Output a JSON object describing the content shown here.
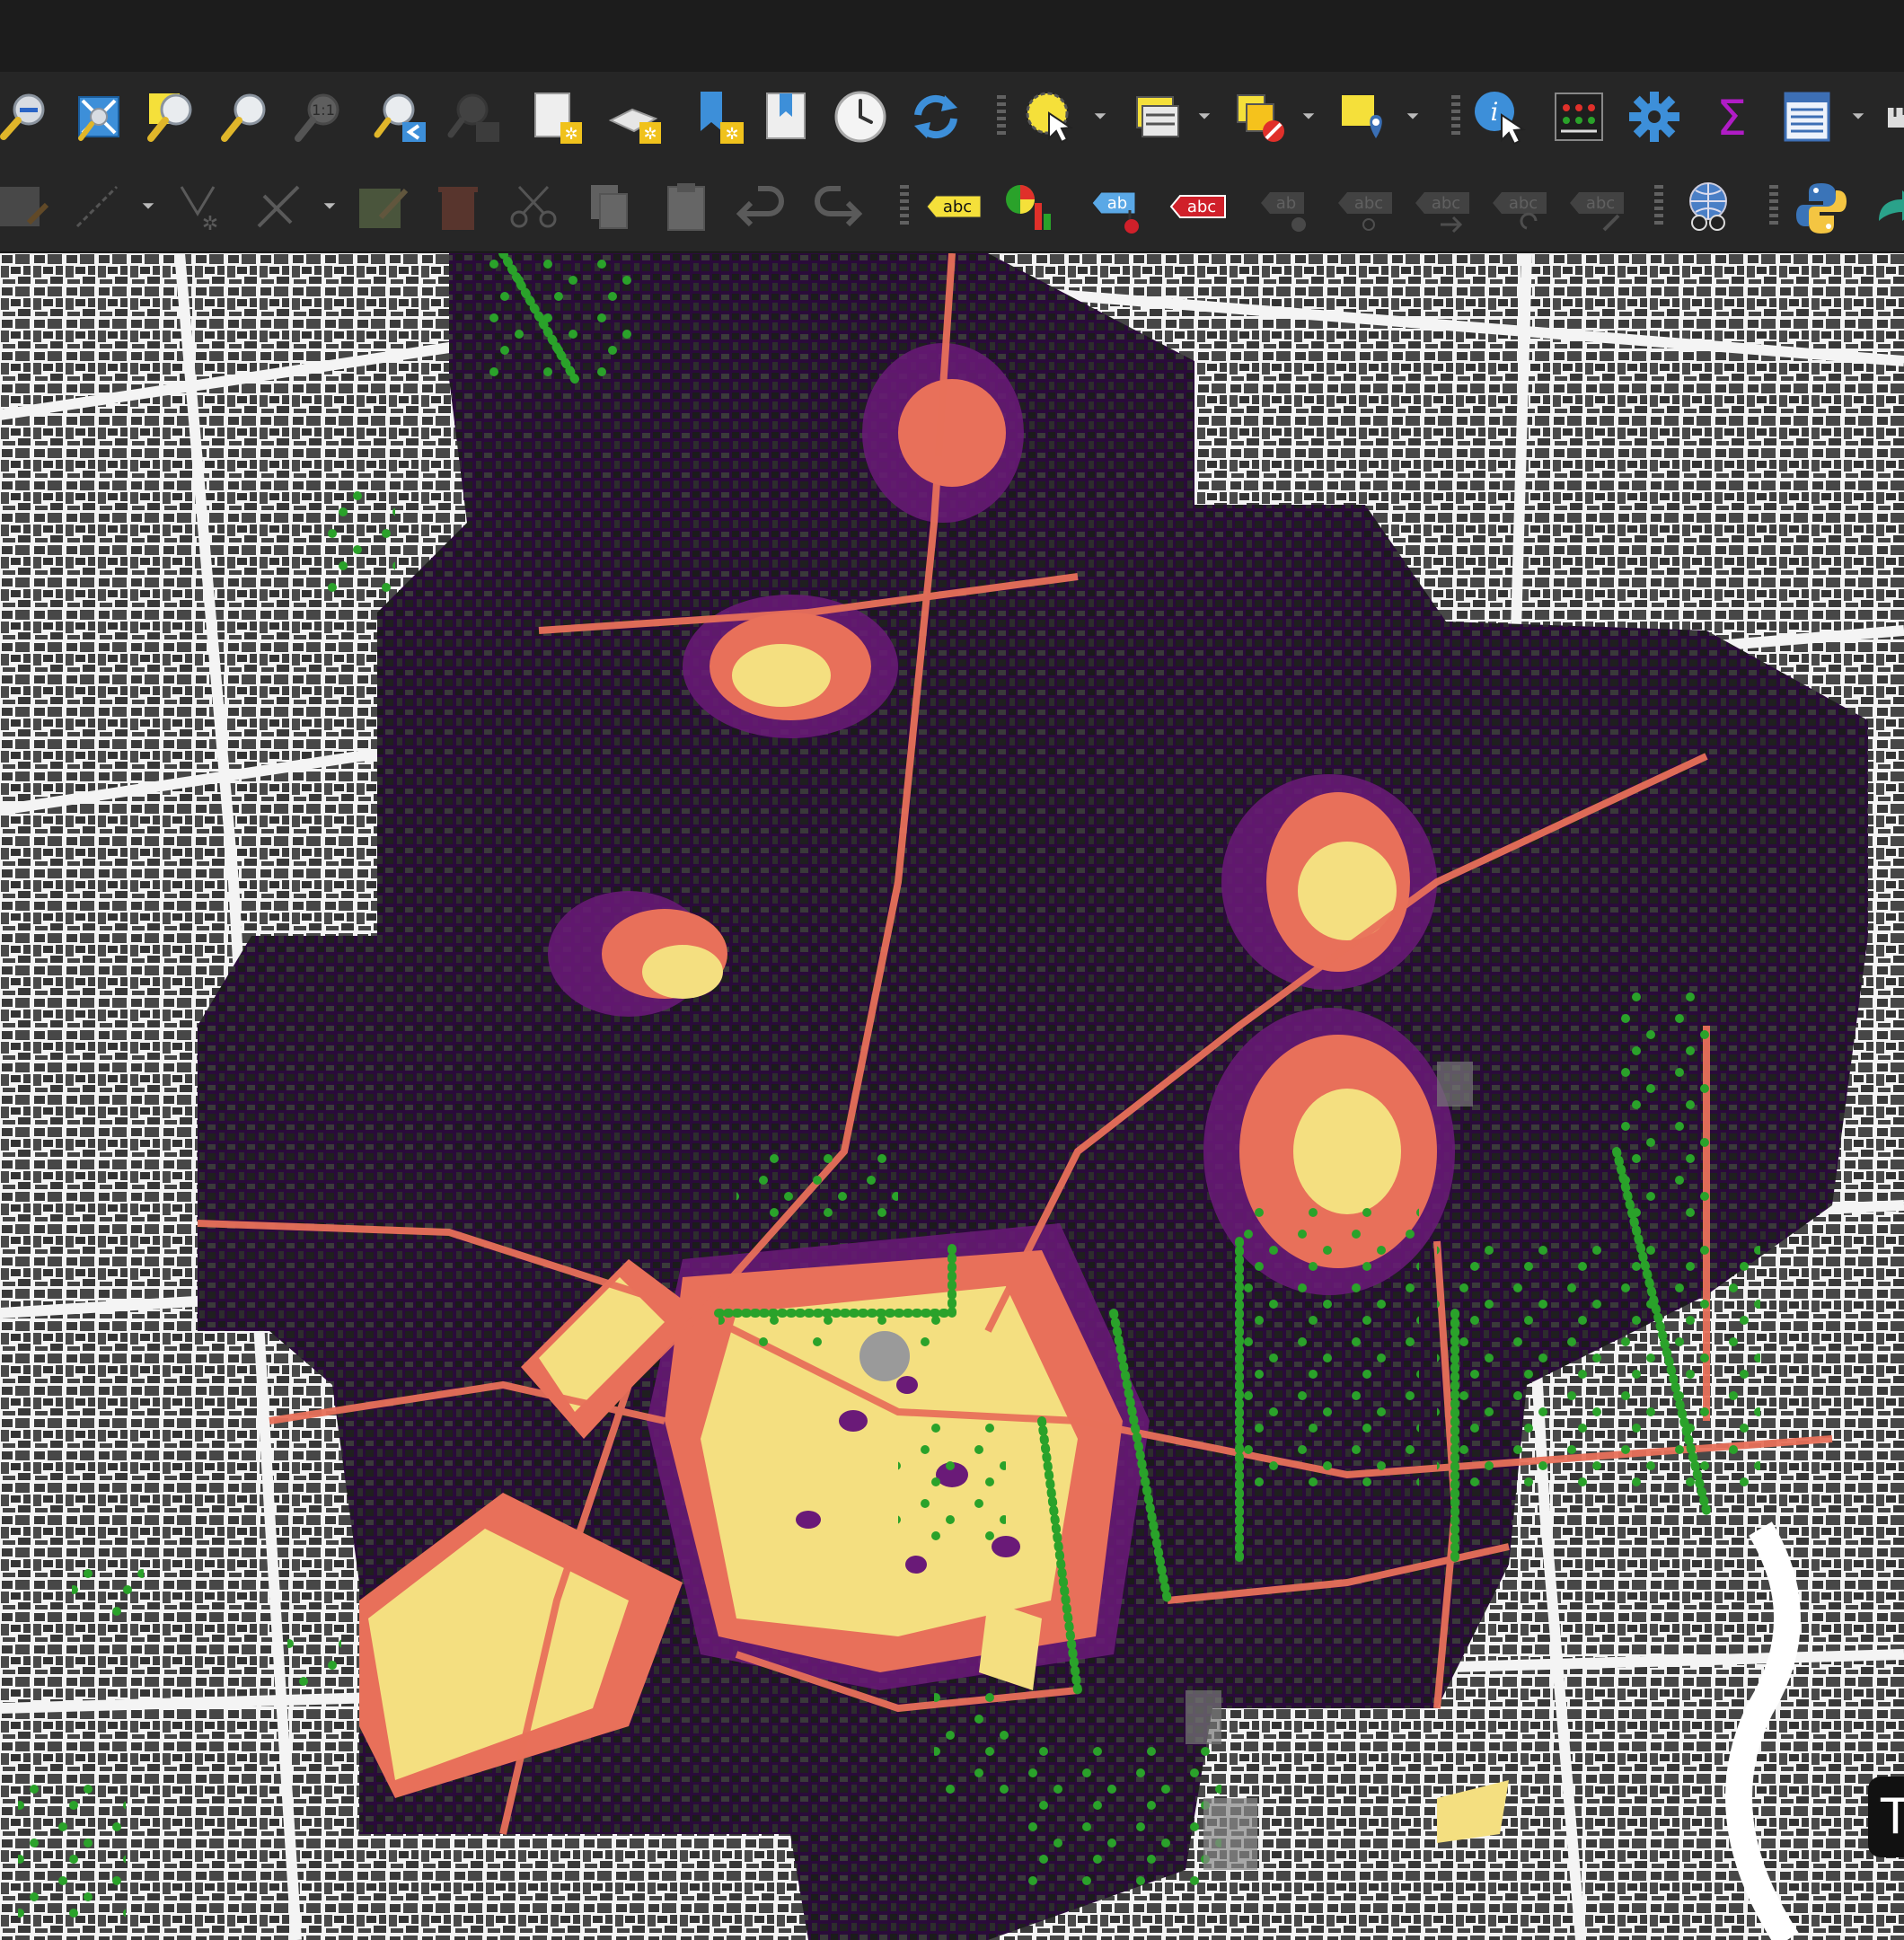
{
  "window": {
    "title": ""
  },
  "toolbar_nav": {
    "items": [
      {
        "name": "zoom-out-icon"
      },
      {
        "name": "zoom-full-icon"
      },
      {
        "name": "zoom-to-selection-icon"
      },
      {
        "name": "zoom-to-layer-icon"
      },
      {
        "name": "zoom-native-resolution-icon",
        "label": "1:1"
      },
      {
        "name": "zoom-last-icon"
      },
      {
        "name": "zoom-next-icon"
      },
      {
        "name": "new-map-view-icon"
      },
      {
        "name": "new-3d-map-view-icon"
      },
      {
        "name": "new-spatial-bookmark-icon"
      },
      {
        "name": "show-spatial-bookmarks-icon"
      },
      {
        "name": "temporal-controller-icon"
      },
      {
        "name": "refresh-icon"
      },
      {
        "name": "select-features-icon"
      },
      {
        "name": "open-attribute-table-icon"
      },
      {
        "name": "deselect-features-icon"
      },
      {
        "name": "select-by-location-icon"
      },
      {
        "name": "identify-features-icon"
      },
      {
        "name": "field-calculator-icon"
      },
      {
        "name": "toolbox-gear-icon"
      },
      {
        "name": "statistics-sum-icon",
        "label": "Σ"
      },
      {
        "name": "attribute-table-icon"
      }
    ]
  },
  "toolbar_edit": {
    "items": [
      {
        "name": "save-edits-icon"
      },
      {
        "name": "digitize-line-icon"
      },
      {
        "name": "vertex-tool-icon"
      },
      {
        "name": "digitize-options-icon"
      },
      {
        "name": "modify-attributes-icon"
      },
      {
        "name": "delete-selected-icon"
      },
      {
        "name": "cut-features-icon"
      },
      {
        "name": "copy-features-icon"
      },
      {
        "name": "paste-features-icon"
      },
      {
        "name": "undo-icon"
      },
      {
        "name": "redo-icon"
      },
      {
        "name": "layer-labeling-icon",
        "label": "abc"
      },
      {
        "name": "layer-diagram-icon"
      },
      {
        "name": "pin-labels-icon",
        "label": "ab"
      },
      {
        "name": "highlight-pinned-labels-icon",
        "label": "abc"
      },
      {
        "name": "move-label-icon",
        "label": "ab"
      },
      {
        "name": "show-hide-labels-icon",
        "label": "abc"
      },
      {
        "name": "move-label-callout-icon",
        "label": "abc"
      },
      {
        "name": "rotate-label-icon",
        "label": "abc"
      },
      {
        "name": "change-label-icon",
        "label": "abc"
      },
      {
        "name": "metasearch-icon"
      },
      {
        "name": "python-console-icon"
      }
    ]
  },
  "map": {
    "description_colors": {
      "background": "#f4f4f4",
      "buildings": "#3d3d3d",
      "heat_dark": "#2a0b3a",
      "heat_purple": "#6a1a78",
      "heat_coral": "#e8705a",
      "heat_yellow": "#f4df80",
      "points": "#2aa22a"
    }
  },
  "floating": {
    "label": "T"
  }
}
